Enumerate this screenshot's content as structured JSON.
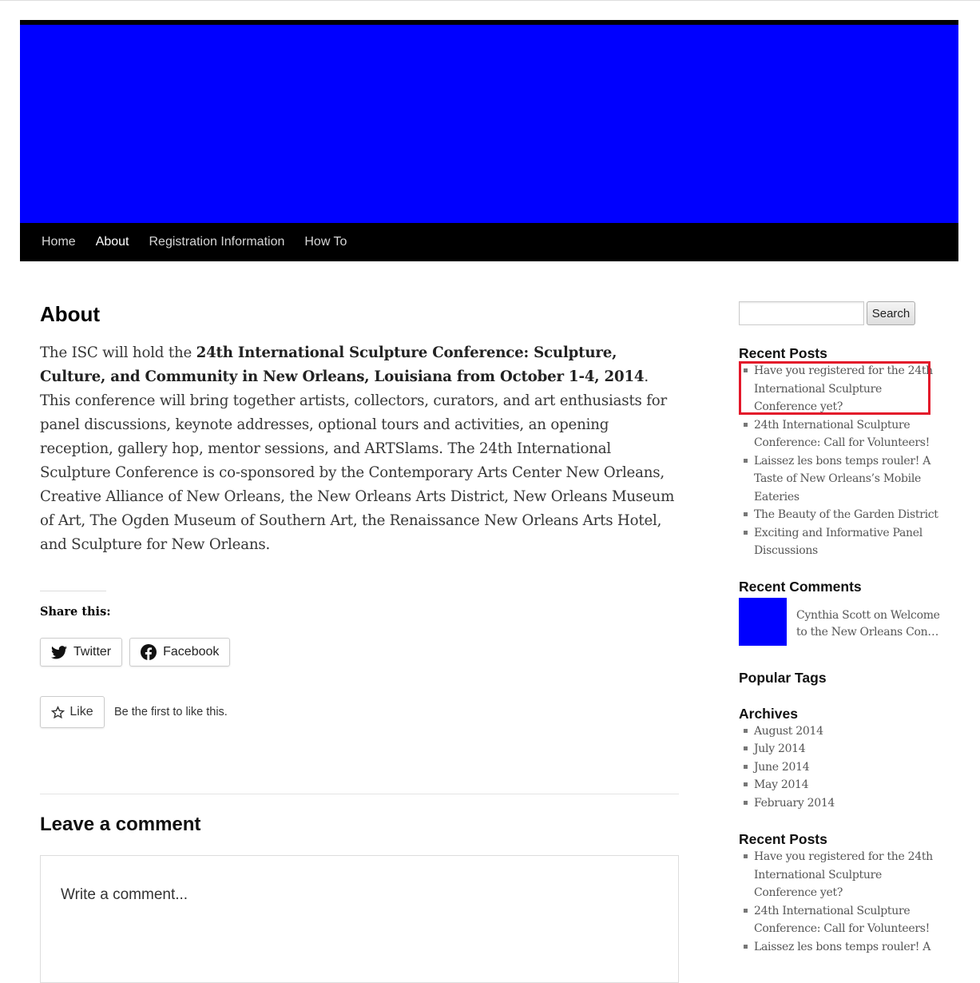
{
  "nav": {
    "items": [
      {
        "label": "Home"
      },
      {
        "label": "About"
      },
      {
        "label": "Registration Information"
      },
      {
        "label": "How To"
      }
    ]
  },
  "page": {
    "title": "About",
    "intro": "The ISC will hold the ",
    "bold": "24th International Sculpture Conference: Sculpture, Culture, and Community in New Orleans, Louisiana from October 1-4, 2014",
    "body": ". This conference will bring together artists, collectors, curators, and art enthusiasts for panel discussions, keynote addresses, optional tours and activities, an opening reception, gallery hop, mentor sessions, and ARTSlams. The 24th International Sculpture Conference is co-sponsored by the Contemporary Arts Center New Orleans, Creative Alliance of New Orleans, the New Orleans Arts District, New Orleans Museum of Art, The Ogden Museum of Southern Art, the Renaissance New Orleans Arts Hotel, and Sculpture for New Orleans."
  },
  "share": {
    "title": "Share this:",
    "twitter": "Twitter",
    "facebook": "Facebook"
  },
  "like": {
    "button": "Like",
    "text": "Be the first to like this."
  },
  "comments": {
    "title": "Leave a comment",
    "placeholder": "Write a comment..."
  },
  "sidebar": {
    "search_button": "Search",
    "recent_posts_title": "Recent Posts",
    "recent_posts": [
      "Have you registered for the 24th International Sculpture Conference yet?",
      "24th International Sculpture Conference: Call for Volunteers!",
      "Laissez les bons temps rouler! A Taste of New Orleans’s Mobile Eateries",
      "The Beauty of the Garden District",
      "Exciting and Informative Panel Discussions"
    ],
    "recent_comments_title": "Recent Comments",
    "recent_comment": "Cynthia Scott on Welcome to the New Orleans Con…",
    "popular_tags_title": "Popular Tags",
    "archives_title": "Archives",
    "archives": [
      "August 2014",
      "July 2014",
      "June 2014",
      "May 2014",
      "February 2014"
    ],
    "recent_posts_title_2": "Recent Posts",
    "recent_posts_2": [
      "Have you registered for the 24th International Sculpture Conference yet?",
      "24th International Sculpture Conference: Call for Volunteers!",
      "Laissez les bons temps rouler! A"
    ]
  },
  "colors": {
    "banner": "#0000ff",
    "nav_bg": "#000000",
    "highlight": "#e3172a"
  }
}
